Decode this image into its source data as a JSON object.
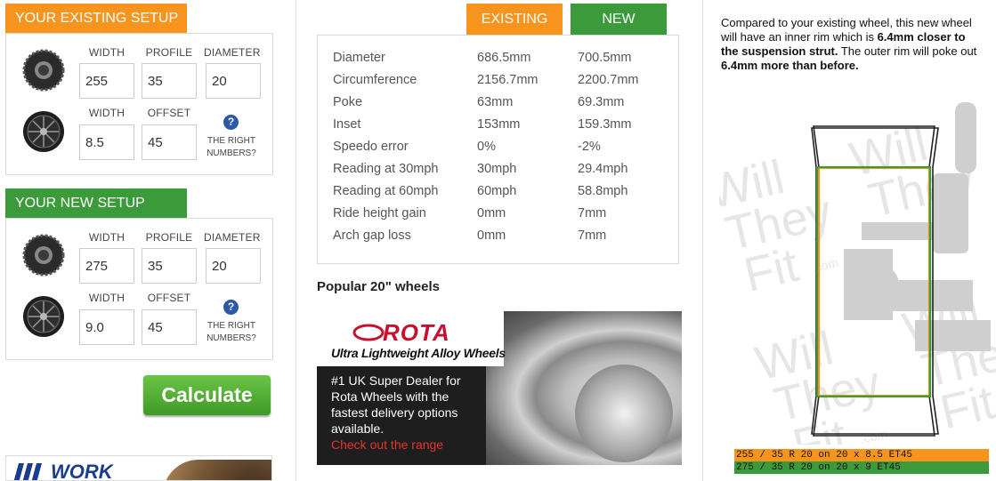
{
  "existing_setup": {
    "title": "YOUR EXISTING SETUP",
    "tyre_labels": {
      "width": "WIDTH",
      "profile": "PROFILE",
      "diameter": "DIAMETER"
    },
    "tyre_values": {
      "width": "255",
      "profile": "35",
      "diameter": "20"
    },
    "wheel_labels": {
      "width": "WIDTH",
      "offset": "OFFSET"
    },
    "wheel_values": {
      "width": "8.5",
      "offset": "45"
    },
    "help_line1": "THE RIGHT",
    "help_line2": "NUMBERS?"
  },
  "new_setup": {
    "title": "YOUR NEW SETUP",
    "tyre_labels": {
      "width": "WIDTH",
      "profile": "PROFILE",
      "diameter": "DIAMETER"
    },
    "tyre_values": {
      "width": "275",
      "profile": "35",
      "diameter": "20"
    },
    "wheel_labels": {
      "width": "WIDTH",
      "offset": "OFFSET"
    },
    "wheel_values": {
      "width": "9.0",
      "offset": "45"
    },
    "help_line1": "THE RIGHT",
    "help_line2": "NUMBERS?"
  },
  "calculate_label": "Calculate",
  "work_ad_text": "WORK",
  "comparison": {
    "col_existing": "EXISTING",
    "col_new": "NEW",
    "rows": [
      {
        "label": "Diameter",
        "existing": "686.5mm",
        "new": "700.5mm"
      },
      {
        "label": "Circumference",
        "existing": "2156.7mm",
        "new": "2200.7mm"
      },
      {
        "label": "Poke",
        "existing": "63mm",
        "new": "69.3mm"
      },
      {
        "label": "Inset",
        "existing": "153mm",
        "new": "159.3mm"
      },
      {
        "label": "Speedo error",
        "existing": "0%",
        "new": "-2%"
      },
      {
        "label": "Reading at 30mph",
        "existing": "30mph",
        "new": "29.4mph"
      },
      {
        "label": "Reading at 60mph",
        "existing": "60mph",
        "new": "58.8mph"
      },
      {
        "label": "Ride height gain",
        "existing": "0mm",
        "new": "7mm"
      },
      {
        "label": "Arch gap loss",
        "existing": "0mm",
        "new": "7mm"
      }
    ]
  },
  "popular_title": "Popular 20\" wheels",
  "rota_ad": {
    "brand": "ROTA",
    "tagline": "Ultra Lightweight Alloy Wheels",
    "body": "#1 UK Super Dealer for Rota Wheels with the fastest delivery options available.",
    "cta": "Check out the range"
  },
  "description": {
    "part1": "Compared to your existing wheel, this new wheel will have an inner rim which is ",
    "bold1": "6.4mm closer to the suspension strut.",
    "part2": " The outer rim will poke out ",
    "bold2": "6.4mm more than before."
  },
  "watermark": {
    "will": "Will",
    "they": "They",
    "fit": "Fit",
    "com": ".com"
  },
  "codes": {
    "existing": "255 / 35 R 20 on 20 x 8.5 ET45",
    "new": "275 / 35 R 20 on 20 x 9 ET45"
  },
  "colors": {
    "orange": "#f7941d",
    "green": "#3b9b3b",
    "calc_green": "#4caf2e",
    "help_blue": "#2a5aa6"
  }
}
